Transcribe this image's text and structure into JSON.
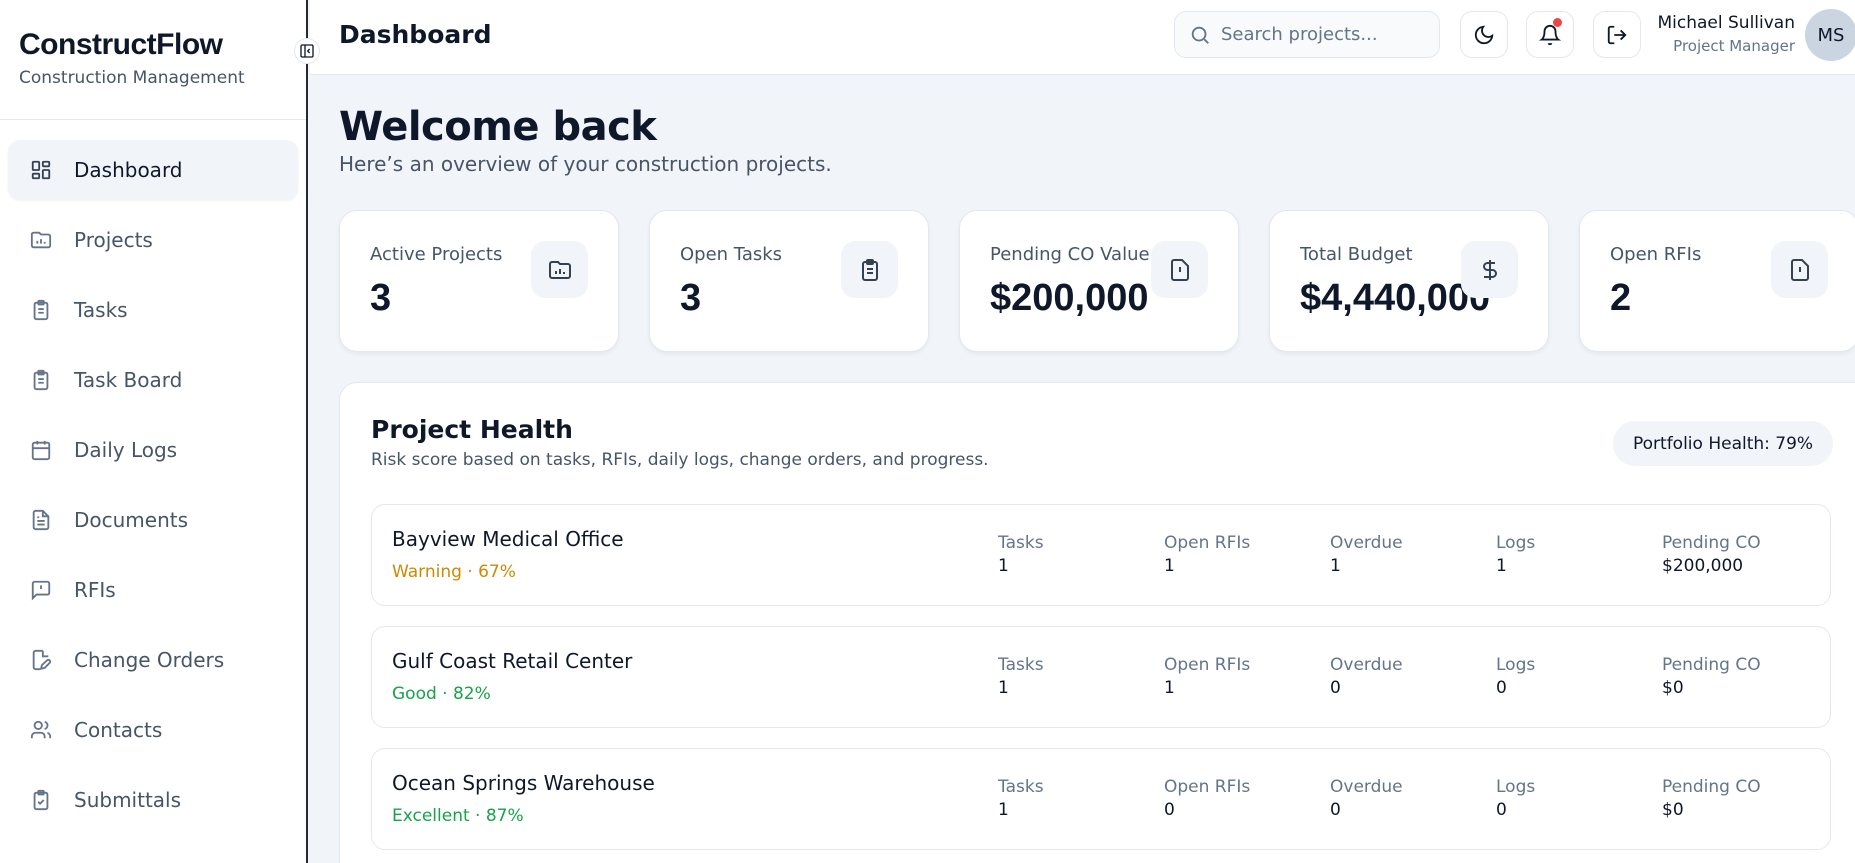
{
  "brand": {
    "title": "ConstructFlow",
    "subtitle": "Construction Management"
  },
  "sidebar": {
    "items": [
      {
        "label": "Dashboard",
        "icon": "dashboard-icon",
        "active": true
      },
      {
        "label": "Projects",
        "icon": "folder-chart-icon"
      },
      {
        "label": "Tasks",
        "icon": "clipboard-list-icon"
      },
      {
        "label": "Task Board",
        "icon": "clipboard-list-icon"
      },
      {
        "label": "Daily Logs",
        "icon": "calendar-icon"
      },
      {
        "label": "Documents",
        "icon": "file-text-icon"
      },
      {
        "label": "RFIs",
        "icon": "message-alert-icon"
      },
      {
        "label": "Change Orders",
        "icon": "file-edit-icon"
      },
      {
        "label": "Contacts",
        "icon": "users-icon"
      },
      {
        "label": "Submittals",
        "icon": "clipboard-check-icon"
      }
    ]
  },
  "header": {
    "title": "Dashboard",
    "search_placeholder": "Search projects...",
    "user_name": "Michael Sullivan",
    "user_role": "Project Manager",
    "avatar_initials": "MS"
  },
  "main": {
    "welcome": "Welcome back",
    "welcome_sub": "Here’s an overview of your construction projects.",
    "stats": [
      {
        "label": "Active Projects",
        "value": "3",
        "icon": "folder-chart-icon"
      },
      {
        "label": "Open Tasks",
        "value": "3",
        "icon": "clipboard-list-icon"
      },
      {
        "label": "Pending CO Value",
        "value": "$200,000",
        "icon": "file-alert-icon"
      },
      {
        "label": "Total Budget",
        "value": "$4,440,000",
        "icon": "dollar-icon"
      },
      {
        "label": "Open RFIs",
        "value": "2",
        "icon": "file-alert-icon"
      }
    ]
  },
  "health": {
    "title": "Project Health",
    "subtitle": "Risk score based on tasks, RFIs, daily logs, change orders, and progress.",
    "portfolio": "Portfolio Health: 79%",
    "metric_labels": [
      "Tasks",
      "Open RFIs",
      "Overdue",
      "Logs",
      "Pending CO"
    ],
    "projects": [
      {
        "name": "Bayview Medical Office",
        "status": "Warning · 67%",
        "status_color": "#ca8a04",
        "values": [
          "1",
          "1",
          "1",
          "1",
          "$200,000"
        ]
      },
      {
        "name": "Gulf Coast Retail Center",
        "status": "Good · 82%",
        "status_color": "#16a34a",
        "values": [
          "1",
          "1",
          "0",
          "0",
          "$0"
        ]
      },
      {
        "name": "Ocean Springs Warehouse",
        "status": "Excellent · 87%",
        "status_color": "#16a34a",
        "values": [
          "1",
          "0",
          "0",
          "0",
          "$0"
        ]
      }
    ]
  }
}
